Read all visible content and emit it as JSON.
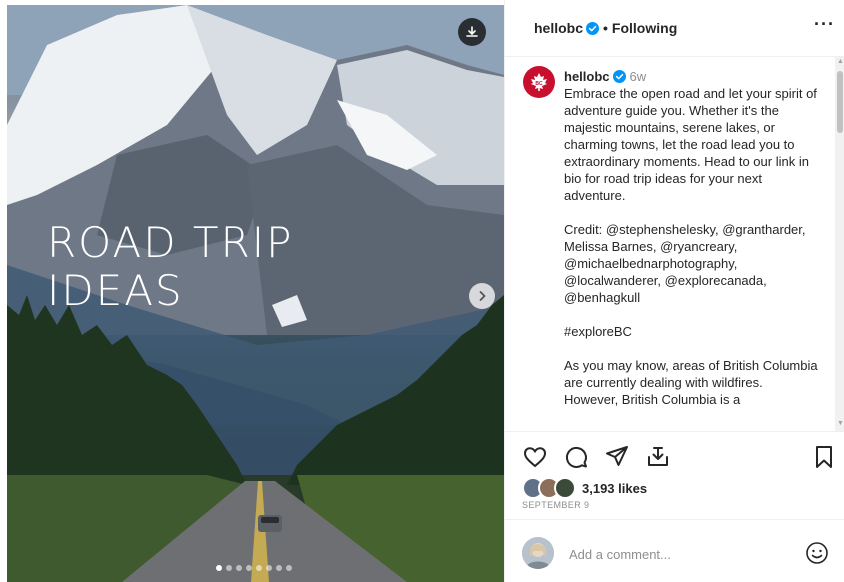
{
  "media": {
    "overlay_line1": "ROAD TRIP",
    "overlay_line2": "IDEAS",
    "carousel_total": 8,
    "carousel_active": 1
  },
  "header": {
    "username": "hellobc",
    "separator": "•",
    "follow_status": "Following",
    "more": "···"
  },
  "caption": {
    "username": "hellobc",
    "time_ago": "6w",
    "lines": [
      "Embrace the open road and let your spirit of adventure guide you. Whether it's the majestic mountains, serene lakes, or charming towns, let the road lead you to extraordinary moments. Head to our link in bio for road trip ideas for your next adventure.",
      "",
      "Credit: @stephenshelesky, @grantharder, Melissa Barnes, @ryancreary, @michaelbednarphotography, @localwanderer, @explorecanada, @benhagkull",
      "",
      "#exploreBC",
      "",
      "As you may know, areas of British Columbia are currently dealing with wildfires. However, British Columbia is a"
    ]
  },
  "engagement": {
    "likes": "3,193 likes",
    "date": "SEPTEMBER 9"
  },
  "comment": {
    "placeholder": "Add a comment..."
  },
  "icons": {
    "download": "download-icon",
    "next": "chevron-right-icon",
    "verified": "verified-badge-icon",
    "like": "heart-icon",
    "comment": "comment-icon",
    "share": "paper-plane-icon",
    "remix": "remix-icon",
    "save": "bookmark-icon",
    "emoji": "emoji-icon"
  },
  "colors": {
    "brand_red": "#c8102e",
    "verified_blue": "#0095f6",
    "text_primary": "#262626",
    "text_secondary": "#8e8e8e"
  }
}
